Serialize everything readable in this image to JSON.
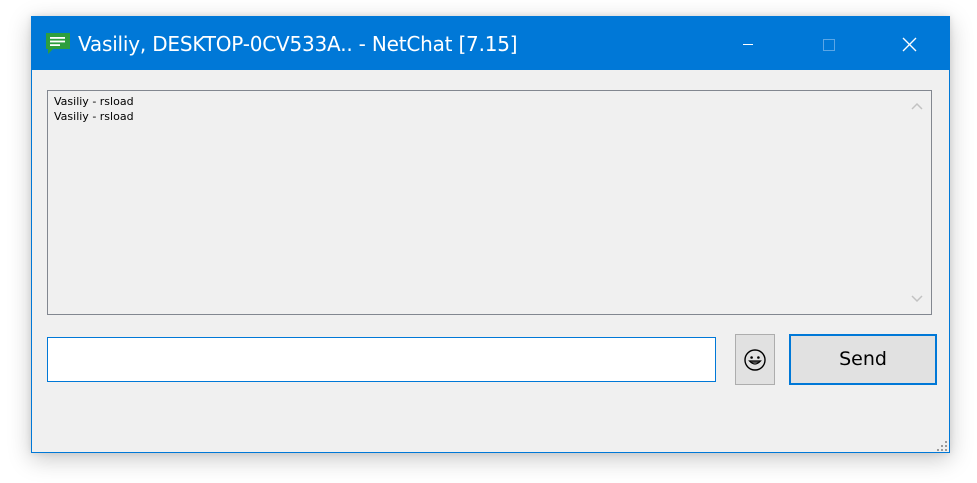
{
  "window": {
    "title": "Vasiliy, DESKTOP-0CV533A.. - NetChat [7.15]",
    "icon": "netchat-message-icon",
    "controls": {
      "minimize": "minimize-icon",
      "maximize": "maximize-icon",
      "close": "close-icon"
    },
    "colors": {
      "titlebar": "#0078d7",
      "app_icon": "#2e9e3e",
      "client_background": "#f0f0f0"
    }
  },
  "chat_log": {
    "lines": [
      "Vasiliy - rsload",
      "Vasiliy - rsload"
    ],
    "scroll_up_icon": "chevron-up-icon",
    "scroll_down_icon": "chevron-down-icon"
  },
  "composer": {
    "message_value": "",
    "emoji_icon": "smiley-face-icon",
    "send_label": "Send"
  }
}
